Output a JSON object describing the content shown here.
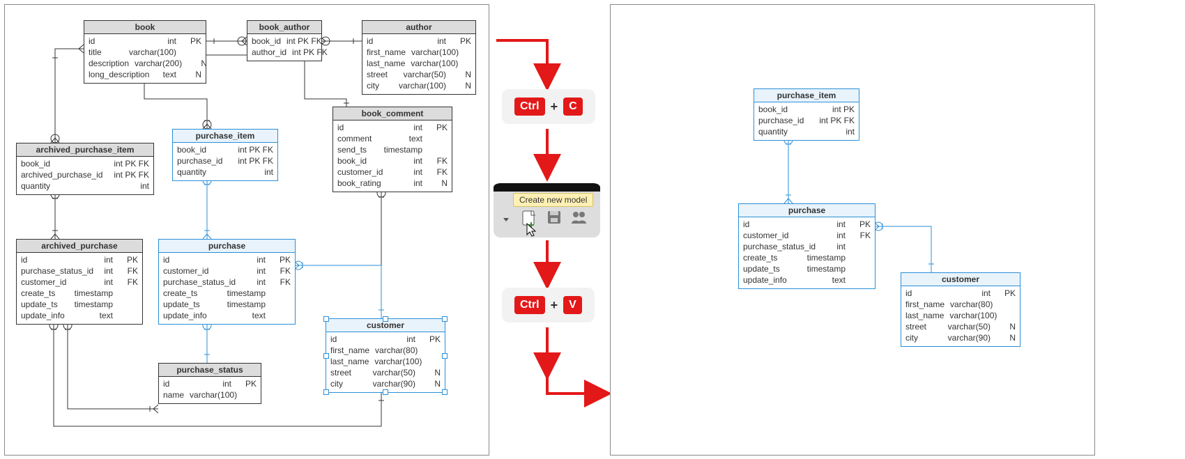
{
  "left": {
    "book": {
      "title": "book",
      "rows": [
        {
          "n": "id",
          "t": "int",
          "k": "PK"
        },
        {
          "n": "title",
          "t": "varchar(100)",
          "k": ""
        },
        {
          "n": "description",
          "t": "varchar(200)",
          "k": "N"
        },
        {
          "n": "long_description",
          "t": "text",
          "k": "N"
        }
      ]
    },
    "book_author": {
      "title": "book_author",
      "rows": [
        {
          "n": "book_id",
          "t": "int PK FK",
          "k": ""
        },
        {
          "n": "author_id",
          "t": "int PK FK",
          "k": ""
        }
      ]
    },
    "author": {
      "title": "author",
      "rows": [
        {
          "n": "id",
          "t": "int",
          "k": "PK"
        },
        {
          "n": "first_name",
          "t": "varchar(100)",
          "k": ""
        },
        {
          "n": "last_name",
          "t": "varchar(100)",
          "k": ""
        },
        {
          "n": "street",
          "t": "varchar(50)",
          "k": "N"
        },
        {
          "n": "city",
          "t": "varchar(100)",
          "k": "N"
        }
      ]
    },
    "archived_purchase_item": {
      "title": "archived_purchase_item",
      "rows": [
        {
          "n": "book_id",
          "t": "int PK FK",
          "k": ""
        },
        {
          "n": "archived_purchase_id",
          "t": "int PK FK",
          "k": ""
        },
        {
          "n": "quantity",
          "t": "int",
          "k": ""
        }
      ]
    },
    "purchase_item": {
      "title": "purchase_item",
      "rows": [
        {
          "n": "book_id",
          "t": "int PK FK",
          "k": ""
        },
        {
          "n": "purchase_id",
          "t": "int PK FK",
          "k": ""
        },
        {
          "n": "quantity",
          "t": "int",
          "k": ""
        }
      ]
    },
    "book_comment": {
      "title": "book_comment",
      "rows": [
        {
          "n": "id",
          "t": "int",
          "k": "PK"
        },
        {
          "n": "comment",
          "t": "text",
          "k": ""
        },
        {
          "n": "send_ts",
          "t": "timestamp",
          "k": ""
        },
        {
          "n": "book_id",
          "t": "int",
          "k": "FK"
        },
        {
          "n": "customer_id",
          "t": "int",
          "k": "FK"
        },
        {
          "n": "book_rating",
          "t": "int",
          "k": "N"
        }
      ]
    },
    "archived_purchase": {
      "title": "archived_purchase",
      "rows": [
        {
          "n": "id",
          "t": "int",
          "k": "PK"
        },
        {
          "n": "purchase_status_id",
          "t": "int",
          "k": "FK"
        },
        {
          "n": "customer_id",
          "t": "int",
          "k": "FK"
        },
        {
          "n": "create_ts",
          "t": "timestamp",
          "k": ""
        },
        {
          "n": "update_ts",
          "t": "timestamp",
          "k": ""
        },
        {
          "n": "update_info",
          "t": "text",
          "k": ""
        }
      ]
    },
    "purchase": {
      "title": "purchase",
      "rows": [
        {
          "n": "id",
          "t": "int",
          "k": "PK"
        },
        {
          "n": "customer_id",
          "t": "int",
          "k": "FK"
        },
        {
          "n": "purchase_status_id",
          "t": "int",
          "k": "FK"
        },
        {
          "n": "create_ts",
          "t": "timestamp",
          "k": ""
        },
        {
          "n": "update_ts",
          "t": "timestamp",
          "k": ""
        },
        {
          "n": "update_info",
          "t": "text",
          "k": ""
        }
      ]
    },
    "customer": {
      "title": "customer",
      "rows": [
        {
          "n": "id",
          "t": "int",
          "k": "PK"
        },
        {
          "n": "first_name",
          "t": "varchar(80)",
          "k": ""
        },
        {
          "n": "last_name",
          "t": "varchar(100)",
          "k": ""
        },
        {
          "n": "street",
          "t": "varchar(50)",
          "k": "N"
        },
        {
          "n": "city",
          "t": "varchar(90)",
          "k": "N"
        }
      ]
    },
    "purchase_status": {
      "title": "purchase_status",
      "rows": [
        {
          "n": "id",
          "t": "int",
          "k": "PK"
        },
        {
          "n": "name",
          "t": "varchar(100)",
          "k": ""
        }
      ]
    }
  },
  "right": {
    "purchase_item": {
      "title": "purchase_item",
      "rows": [
        {
          "n": "book_id",
          "t": "int PK",
          "k": ""
        },
        {
          "n": "purchase_id",
          "t": "int PK FK",
          "k": ""
        },
        {
          "n": "quantity",
          "t": "int",
          "k": ""
        }
      ]
    },
    "purchase": {
      "title": "purchase",
      "rows": [
        {
          "n": "id",
          "t": "int",
          "k": "PK"
        },
        {
          "n": "customer_id",
          "t": "int",
          "k": "FK"
        },
        {
          "n": "purchase_status_id",
          "t": "int",
          "k": ""
        },
        {
          "n": "create_ts",
          "t": "timestamp",
          "k": ""
        },
        {
          "n": "update_ts",
          "t": "timestamp",
          "k": ""
        },
        {
          "n": "update_info",
          "t": "text",
          "k": ""
        }
      ]
    },
    "customer": {
      "title": "customer",
      "rows": [
        {
          "n": "id",
          "t": "int",
          "k": "PK"
        },
        {
          "n": "first_name",
          "t": "varchar(80)",
          "k": ""
        },
        {
          "n": "last_name",
          "t": "varchar(100)",
          "k": ""
        },
        {
          "n": "street",
          "t": "varchar(50)",
          "k": "N"
        },
        {
          "n": "city",
          "t": "varchar(90)",
          "k": "N"
        }
      ]
    }
  },
  "flow": {
    "ctrl": "Ctrl",
    "c": "C",
    "v": "V",
    "plus": "+",
    "tooltip": "Create new model"
  }
}
